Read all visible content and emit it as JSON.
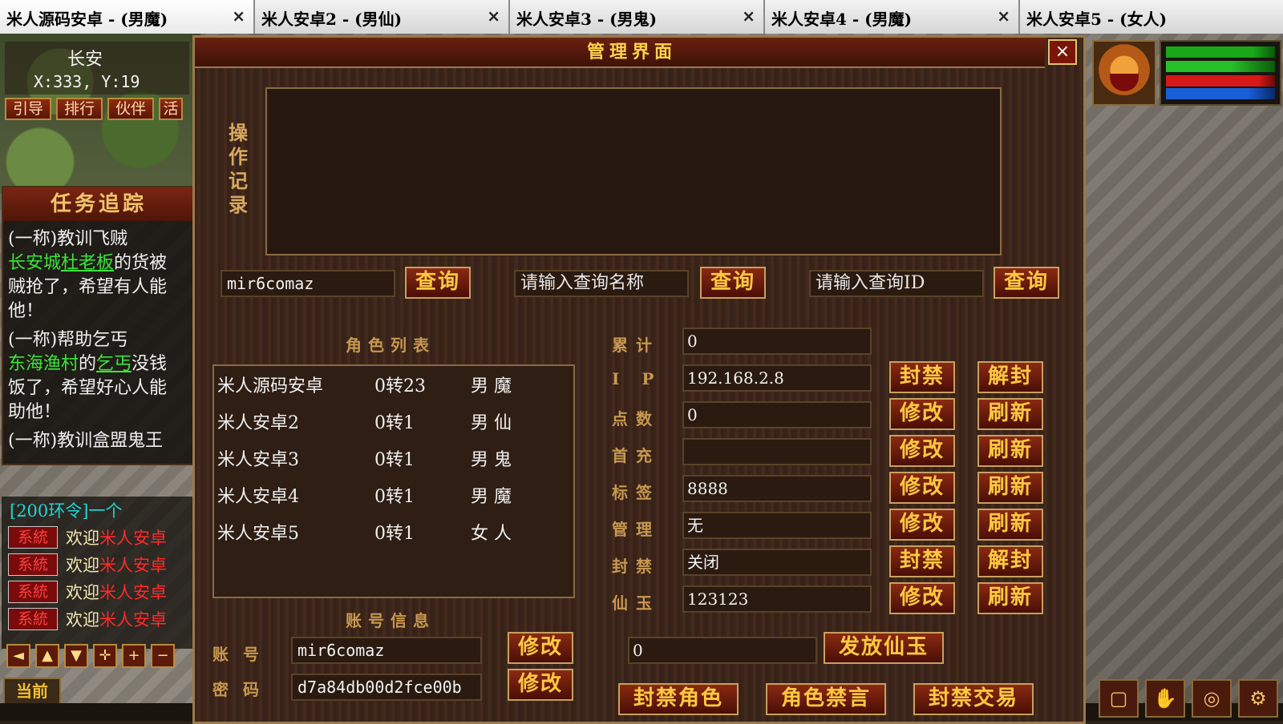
{
  "tabs": [
    {
      "title": "米人源码安卓 - (男魔)",
      "close": "×"
    },
    {
      "title": "米人安卓2 - (男仙)",
      "close": "×"
    },
    {
      "title": "米人安卓3 - (男鬼)",
      "close": "×"
    },
    {
      "title": "米人安卓4 - (男魔)",
      "close": "×"
    },
    {
      "title": "米人安卓5 - (女人)",
      "close": ""
    }
  ],
  "hud": {
    "location": "长安",
    "coords": "X:333, Y:19",
    "buttons": [
      "引导",
      "排行",
      "伙伴",
      "活"
    ],
    "quest_title": "任务追踪",
    "quest": {
      "q1_title": "(一称)教训飞贼",
      "q1_place": "长安城",
      "q1_npc": "杜老板",
      "q1_text1": "的货被",
      "q1_text2": "贼抢了，希望有人能",
      "q1_text3": "他！",
      "q2_title": "(一称)帮助乞丐",
      "q2_place": "东海渔村",
      "q2_of": "的",
      "q2_npc": "乞丐",
      "q2_text1": "没钱",
      "q2_text2": "饭了，希望好心人能",
      "q2_text3": "助他！",
      "q3_title": "(一称)教训盒盟鬼王"
    },
    "ring_order": "[200环令]一个",
    "chat": [
      {
        "tag": "系統",
        "msg": "欢迎",
        "name": "米人安卓"
      },
      {
        "tag": "系統",
        "msg": "欢迎",
        "name": "米人安卓"
      },
      {
        "tag": "系統",
        "msg": "欢迎",
        "name": "米人安卓"
      },
      {
        "tag": "系統",
        "msg": "欢迎",
        "name": "米人安卓"
      }
    ],
    "controls": [
      "◄",
      "▲",
      "▼",
      "✛",
      "+",
      "−"
    ],
    "current": "当前"
  },
  "dialog": {
    "title": "管理界面",
    "close": "×",
    "log_label": "操作记录",
    "search": {
      "account_value": "mir6comaz",
      "name_placeholder": "请输入查询名称",
      "id_placeholder": "请输入查询ID",
      "query_label": "查询"
    },
    "roles_title": "角色列表",
    "roles": [
      {
        "name": "米人源码安卓",
        "level": "0转23",
        "type": "男 魔"
      },
      {
        "name": "米人安卓2",
        "level": "0转1",
        "type": "男 仙"
      },
      {
        "name": "米人安卓3",
        "level": "0转1",
        "type": "男 鬼"
      },
      {
        "name": "米人安卓4",
        "level": "0转1",
        "type": "男 魔"
      },
      {
        "name": "米人安卓5",
        "level": "0转1",
        "type": "女 人"
      }
    ],
    "fields": [
      {
        "label": "累计",
        "value": "0",
        "btn1": "",
        "btn2": ""
      },
      {
        "label": "IP",
        "value": "192.168.2.8",
        "btn1": "封禁",
        "btn2": "解封"
      },
      {
        "label": "点数",
        "value": "0",
        "btn1": "修改",
        "btn2": "刷新"
      },
      {
        "label": "首充",
        "value": "",
        "btn1": "修改",
        "btn2": "刷新"
      },
      {
        "label": "标签",
        "value": "8888",
        "btn1": "修改",
        "btn2": "刷新"
      },
      {
        "label": "管理",
        "value": "无",
        "btn1": "修改",
        "btn2": "刷新"
      },
      {
        "label": "封禁",
        "value": "关闭",
        "btn1": "封禁",
        "btn2": "解封"
      },
      {
        "label": "仙玉",
        "value": "123123",
        "btn1": "修改",
        "btn2": "刷新"
      }
    ],
    "account_title": "账号信息",
    "account": {
      "label": "账号",
      "value": "mir6comaz",
      "password_label": "密码",
      "password_value": "d7a84db00d2fce00b",
      "modify_label": "修改"
    },
    "jade_amount": "0",
    "jade_button": "发放仙玉",
    "bottom_buttons": [
      "封禁角色",
      "角色禁言",
      "封禁交易"
    ]
  }
}
